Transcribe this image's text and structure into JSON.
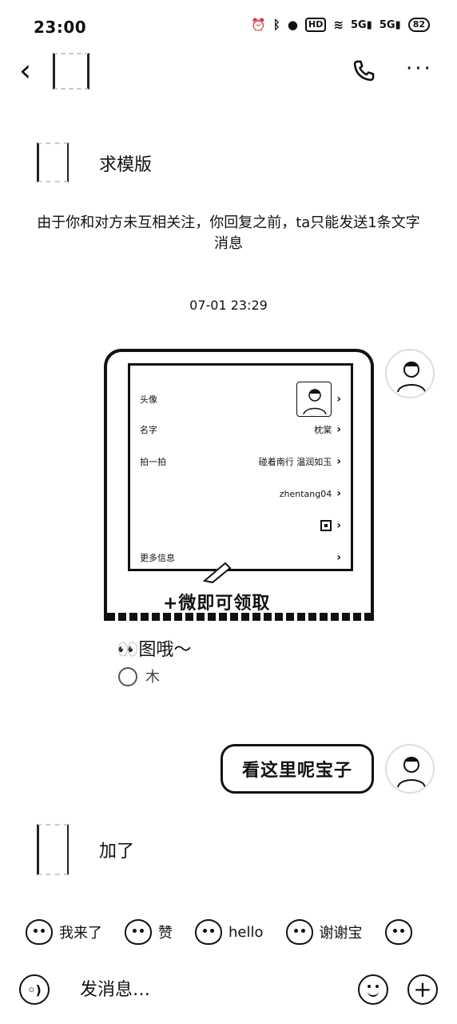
{
  "status_bar": {
    "time": "23:00",
    "hd_label": "HD",
    "network1": "5G",
    "network2": "5G",
    "battery": "82"
  },
  "header": {
    "back_icon": "chevron-left-icon",
    "call_icon": "phone-icon",
    "more_icon": "more-icon"
  },
  "messages": {
    "first": "求模版",
    "notice": "由于你和对方未互相关注，你回复之前，ta只能发送1条文字消息",
    "timestamp": "07-01 23:29",
    "shared_profile": {
      "rows": [
        {
          "label": "头像",
          "value": ""
        },
        {
          "label": "名字",
          "value": "枕棠"
        },
        {
          "label": "拍一拍",
          "value": "碰着南行 温润如玉"
        },
        {
          "label": "",
          "value": "zhentang04"
        },
        {
          "label": "",
          "value": ""
        },
        {
          "label": "更多信息",
          "value": ""
        }
      ],
      "caption": "+微即可领取"
    },
    "card_caption": "👀图哦～",
    "card_ref": "木",
    "reply": "看这里呢宝子",
    "last": "加了"
  },
  "quick_replies": [
    "我来了",
    "赞",
    "hello",
    "谢谢宝"
  ],
  "input": {
    "placeholder": "发消息…"
  }
}
